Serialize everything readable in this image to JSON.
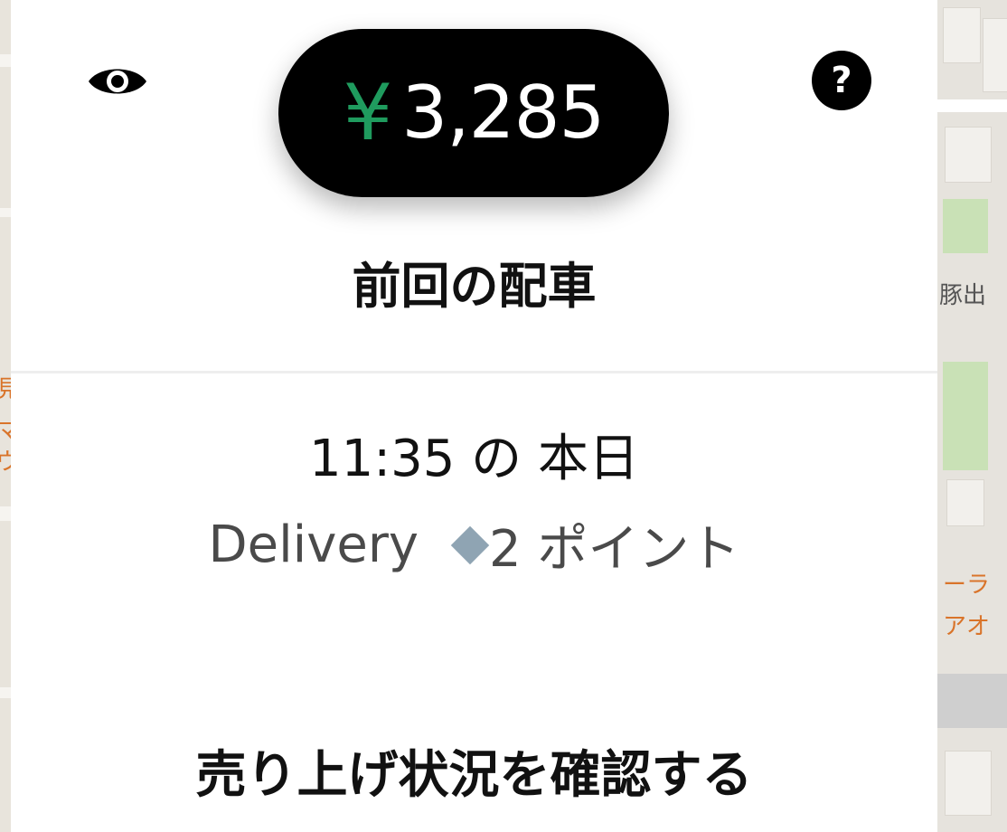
{
  "header": {
    "earnings_currency": "¥",
    "earnings_amount": "3,285",
    "currency_color": "#1f9b5e"
  },
  "icons": {
    "visibility": "eye-icon",
    "help": "question-icon",
    "help_glyph": "?"
  },
  "last_trip": {
    "title": "前回の配車",
    "time_text": "11:35 の 本日",
    "type": "Delivery",
    "points": "2 ポイント",
    "points_color": "#8fa4b3"
  },
  "actions": {
    "view_earnings": "売り上げ状況を確認する"
  },
  "map": {
    "right_labels": [
      "豚出",
      "ーラ",
      "アオ"
    ],
    "left_labels": [
      "見",
      "マ",
      "ヴ"
    ]
  }
}
